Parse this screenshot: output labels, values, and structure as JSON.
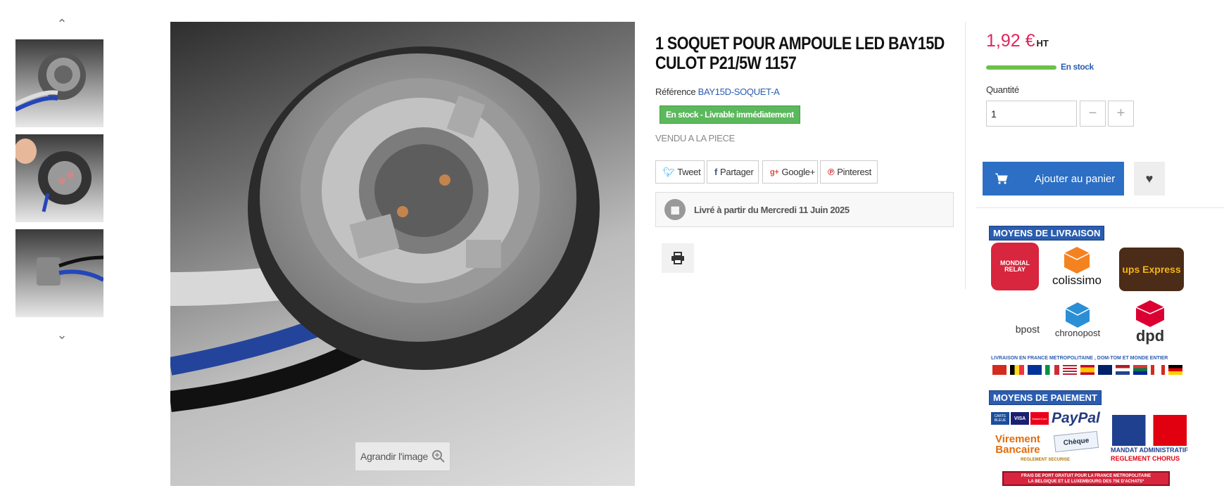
{
  "gallery": {
    "up_arrow": "⌃",
    "down_arrow": "⌄",
    "zoom_label": "Agrandir l'image"
  },
  "product": {
    "title": "1 SOQUET POUR AMPOULE LED BAY15D CULOT P21/5W 1157",
    "reference_label": "Référence",
    "reference_value": "BAY15D-SOQUET-A",
    "stock_badge": "En stock - Livrable immédiatement",
    "unit_note": "VENDU A LA PIECE",
    "share": {
      "tweet": "Tweet",
      "partager": "Partager",
      "google": "Google+",
      "pinterest": "Pinterest"
    },
    "delivery": "Livré à partir du Mercredi 11 Juin 2025"
  },
  "buy": {
    "price": "1,92 €",
    "price_suffix": "HT",
    "stock_level": 1.0,
    "stock_text": "En stock",
    "quantity_label": "Quantité",
    "quantity_value": "1",
    "minus": "−",
    "plus": "+",
    "add_to_cart": "Ajouter au panier"
  },
  "shipping": {
    "title": "MOYENS DE LIVRAISON",
    "carriers": [
      "MONDIAL RELAY",
      "colissimo",
      "ups Express",
      "bpost",
      "chronopost",
      "dpd"
    ],
    "coverage": "LIVRAISON EN FRANCE METROPOLITAINE , DOM-TOM ET MONDE ENTIER"
  },
  "payment": {
    "title": "MOYENS DE PAIEMENT",
    "paypal": "PayPal",
    "carte_bleue": "CARTE BLEUE",
    "visa": "VISA",
    "mastercard": "MasterCard",
    "virement_1": "Virement",
    "virement_2": "Bancaire",
    "cheque": "Chèque",
    "secure": "REGLEMENT SECURISE",
    "mandat_1": "MANDAT ADMINISTRATIF",
    "mandat_2": "REGLEMENT CHORUS",
    "free_shipping_1": "FRAIS DE PORT GRATUIT POUR LA FRANCE METROPOLITAINE",
    "free_shipping_2": "LA BELGIQUE ET LE LUXEMBOURG DES 75€ D'ACHATS*"
  },
  "colors": {
    "accent": "#2c6fc4",
    "price": "#e0245e",
    "stock": "#5cb85c"
  }
}
